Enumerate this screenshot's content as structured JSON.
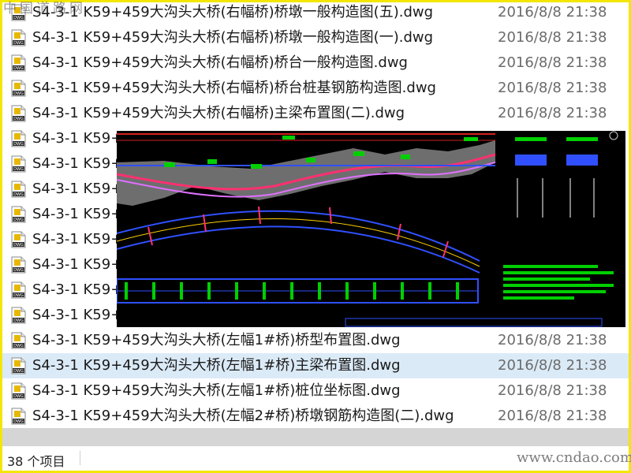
{
  "files": [
    {
      "name": "S4-3-1 K59+459大沟头大桥(右幅桥)桥墩一般构造图(五).dwg",
      "date": "2016/8/8 21:38"
    },
    {
      "name": "S4-3-1 K59+459大沟头大桥(右幅桥)桥墩一般构造图(一).dwg",
      "date": "2016/8/8 21:38"
    },
    {
      "name": "S4-3-1 K59+459大沟头大桥(右幅桥)桥台一般构造图.dwg",
      "date": "2016/8/8 21:38"
    },
    {
      "name": "S4-3-1 K59+459大沟头大桥(右幅桥)桥台桩基钢筋构造图.dwg",
      "date": "2016/8/8 21:38"
    },
    {
      "name": "S4-3-1 K59+459大沟头大桥(右幅桥)主梁布置图(二).dwg",
      "date": "2016/8/8 21:38"
    },
    {
      "name": "S4-3-1 K59+",
      "date": ""
    },
    {
      "name": "S4-3-1 K59+",
      "date": ""
    },
    {
      "name": "S4-3-1 K59+",
      "date": ""
    },
    {
      "name": "S4-3-1 K59+",
      "date": ""
    },
    {
      "name": "S4-3-1 K59+",
      "date": ""
    },
    {
      "name": "S4-3-1 K59+",
      "date": ""
    },
    {
      "name": "S4-3-1 K59+",
      "date": ""
    },
    {
      "name": "S4-3-1 K59+",
      "date": ""
    },
    {
      "name": "S4-3-1 K59+459大沟头大桥(左幅1#桥)桥型布置图.dwg",
      "date": "2016/8/8 21:38"
    },
    {
      "name": "S4-3-1 K59+459大沟头大桥(左幅1#桥)主梁布置图.dwg",
      "date": "2016/8/8 21:38",
      "selected": true
    },
    {
      "name": "S4-3-1 K59+459大沟头大桥(左幅1#桥)桩位坐标图.dwg",
      "date": "2016/8/8 21:38"
    },
    {
      "name": "S4-3-1 K59+459大沟头大桥(左幅2#桥)桥墩钢筋构造图(二).dwg",
      "date": "2016/8/8 21:38"
    }
  ],
  "status": {
    "count": "38 个项目"
  },
  "watermark": {
    "top": "中国道路网",
    "bottom": "www.cndao.com"
  },
  "icon": {
    "name": "dwg-file-icon",
    "label": "DWG",
    "accent": "#e8b800"
  }
}
